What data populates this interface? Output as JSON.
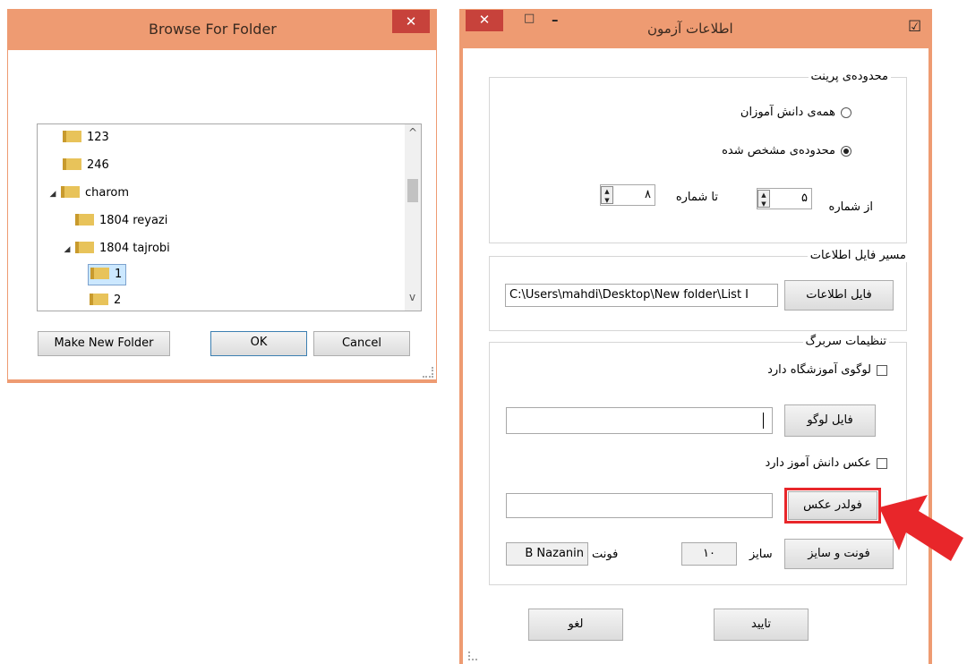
{
  "browse_dialog": {
    "title": "Browse For Folder",
    "close_glyph": "✕",
    "tree": [
      {
        "label": "123",
        "expander": ""
      },
      {
        "label": "246",
        "expander": ""
      },
      {
        "label": "charom",
        "expander": "◢"
      },
      {
        "label": "1804 reyazi",
        "expander": ""
      },
      {
        "label": "1804 tajrobi",
        "expander": "◢"
      },
      {
        "label": "1",
        "expander": ""
      },
      {
        "label": "2",
        "expander": ""
      }
    ],
    "scroll_up": "^",
    "scroll_down": "v",
    "make_new_folder_label": "Make New Folder",
    "ok_label": "OK",
    "cancel_label": "Cancel"
  },
  "exam_dialog": {
    "title": "اطلاعات آزمون",
    "close_glyph": "✕",
    "maximize_glyph": "□",
    "minimize_glyph": "–",
    "check_glyph": "☑",
    "print_range": {
      "legend": "محدوده‌ی پرینت",
      "all_students_label": "همه‌ی دانش آموزان",
      "specified_range_label": "محدوده‌ی مشخص شده",
      "from_label": "از شماره",
      "from_value": "۵",
      "to_label": "تا شماره",
      "to_value": "۸"
    },
    "info_file": {
      "legend": "مسیر فایل اطلاعات",
      "path_value": "C:\\Users\\mahdi\\Desktop\\New folder\\List I",
      "button_label": "فایل اطلاعات"
    },
    "header_settings": {
      "legend": "تنظیمات سربرگ",
      "has_logo_label": "لوگوی آموزشگاه دارد",
      "logo_file_button": "فایل لوگو",
      "logo_value": "",
      "has_photo_label": "عکس دانش آموز دارد",
      "photo_folder_button": "فولدر عکس",
      "photo_value": "",
      "font_size_button": "فونت و سایز",
      "size_label": "سایز",
      "size_value": "۱۰",
      "font_label": "فونت",
      "font_value": "B Nazanin"
    },
    "cancel_label": "لغو",
    "confirm_label": "تایید"
  },
  "colors": {
    "title_bar": "#ee9b72",
    "close_button": "#c7423b",
    "highlight_box": "#e8262a",
    "arrow": "#e8262a"
  }
}
